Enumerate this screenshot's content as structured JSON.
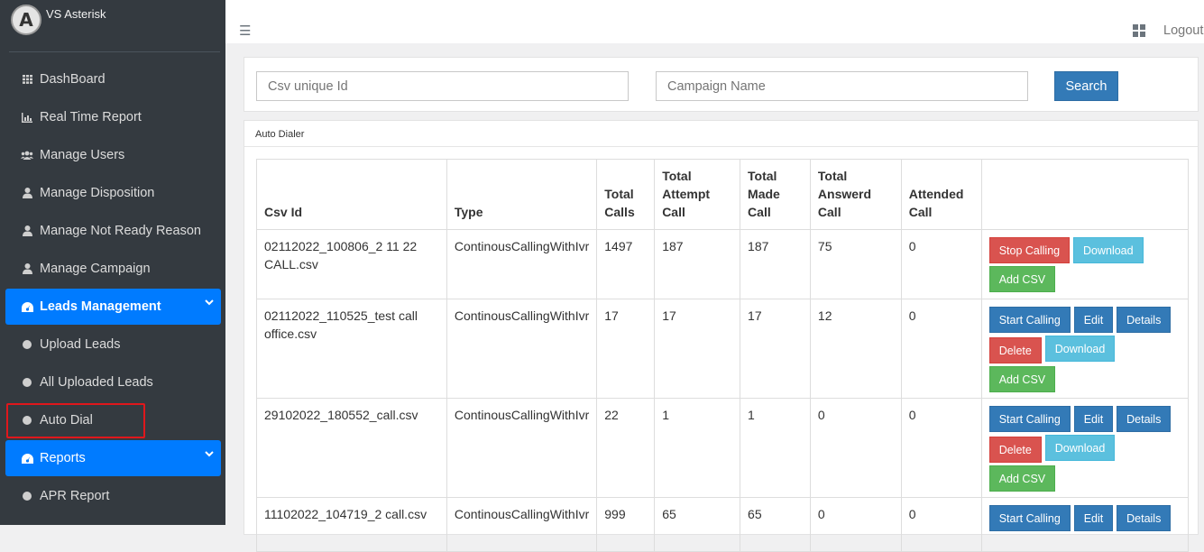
{
  "brand": {
    "logo_letter": "A",
    "name": "VS Asterisk"
  },
  "sidebar": {
    "items": [
      {
        "label": "DashBoard",
        "icon": "grid-icon"
      },
      {
        "label": "Real Time Report",
        "icon": "chart-icon"
      },
      {
        "label": "Manage Users",
        "icon": "users-icon"
      },
      {
        "label": "Manage Disposition",
        "icon": "user-icon"
      },
      {
        "label": "Manage Not Ready Reason",
        "icon": "user-icon"
      },
      {
        "label": "Manage Campaign",
        "icon": "user-icon"
      },
      {
        "label": "Leads Management",
        "icon": "gauge-icon",
        "active": true
      },
      {
        "label": "Upload Leads",
        "icon": "circle-icon"
      },
      {
        "label": "All Uploaded Leads",
        "icon": "circle-icon"
      },
      {
        "label": "Auto Dial",
        "icon": "circle-icon",
        "highlighted": true
      },
      {
        "label": "Reports",
        "icon": "gauge-icon",
        "active": true
      },
      {
        "label": "APR Report",
        "icon": "circle-icon"
      }
    ]
  },
  "topbar": {
    "menu_icon": "☰",
    "logout_label": "Logout"
  },
  "search": {
    "csv_placeholder": "Csv unique Id",
    "campaign_placeholder": "Campaign Name",
    "button_label": "Search"
  },
  "auto_dialer": {
    "title": "Auto Dialer",
    "columns": {
      "csv_id": "Csv Id",
      "type": "Type",
      "total_calls": [
        "Total",
        "Calls"
      ],
      "total_attempt": [
        "Total",
        "Attempt",
        "Call"
      ],
      "total_made": [
        "Total",
        "Made",
        "Call"
      ],
      "total_answerd": [
        "Total",
        "Answerd",
        "Call"
      ],
      "attended": [
        "Attended",
        "Call"
      ]
    },
    "rows": [
      {
        "csv_id": "02112022_100806_2 11 22 CALL.csv",
        "type": "ContinousCallingWithIvr",
        "total_calls": "1497",
        "total_attempt": "187",
        "total_made": "187",
        "total_answerd": "75",
        "attended": "0",
        "actions": [
          [
            "Stop Calling",
            "Download"
          ],
          [
            "Add CSV"
          ]
        ]
      },
      {
        "csv_id": "02112022_110525_test call office.csv",
        "type": "ContinousCallingWithIvr",
        "total_calls": "17",
        "total_attempt": "17",
        "total_made": "17",
        "total_answerd": "12",
        "attended": "0",
        "actions": [
          [
            "Start Calling",
            "Edit",
            "Details"
          ],
          [
            "Delete",
            "Download"
          ],
          [
            "Add CSV"
          ]
        ]
      },
      {
        "csv_id": "29102022_180552_call.csv",
        "type": "ContinousCallingWithIvr",
        "total_calls": "22",
        "total_attempt": "1",
        "total_made": "1",
        "total_answerd": "0",
        "attended": "0",
        "actions": [
          [
            "Start Calling",
            "Edit",
            "Details"
          ],
          [
            "Delete",
            "Download"
          ],
          [
            "Add CSV"
          ]
        ]
      },
      {
        "csv_id": "11102022_104719_2 call.csv",
        "type": "ContinousCallingWithIvr",
        "total_calls": "999",
        "total_attempt": "65",
        "total_made": "65",
        "total_answerd": "0",
        "attended": "0",
        "actions": [
          [
            "Start Calling",
            "Edit",
            "Details"
          ]
        ]
      }
    ]
  },
  "colors": {
    "sidebar_bg": "#343a40",
    "active": "#007bff",
    "primary": "#337ab7",
    "danger": "#d9534f",
    "info": "#5bc0de",
    "success": "#5cb85c",
    "highlight_border": "#e0171c"
  }
}
